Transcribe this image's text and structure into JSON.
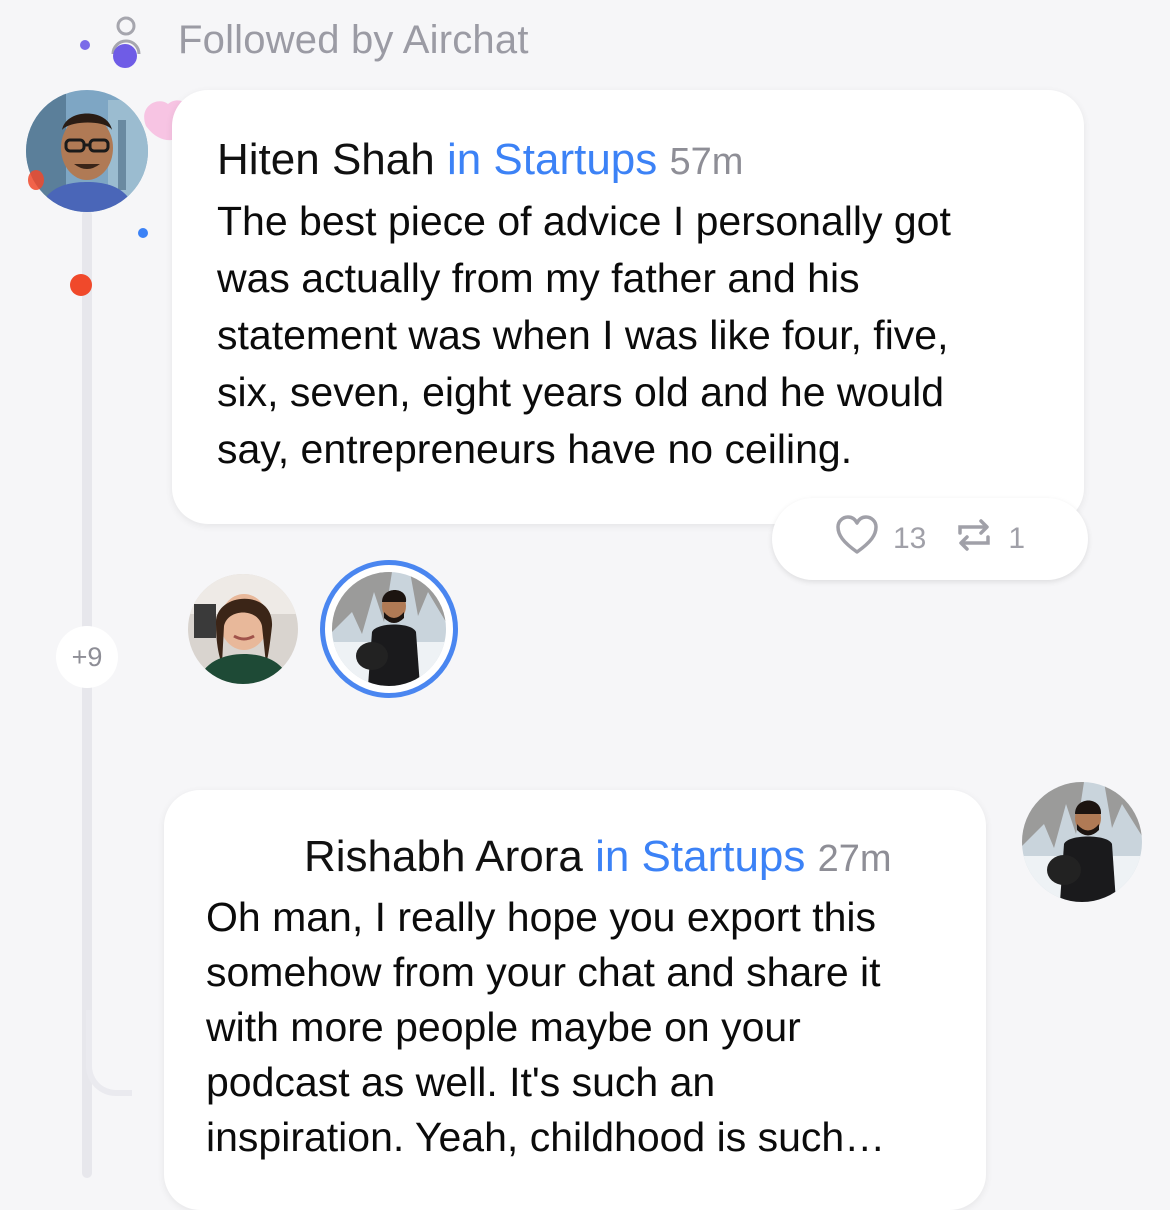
{
  "header": {
    "followed_label": "Followed by Airchat"
  },
  "posts": [
    {
      "author": "Hiten Shah",
      "community": "in Startups",
      "time": "57m",
      "body": "The best piece of advice I personally got\nwas actually from my father and his\nstatement was when I was like four, five,\nsix, seven, eight years old and he would\nsay, entrepreneurs have no ceiling.",
      "likes": "13",
      "reposts": "1"
    },
    {
      "author": "Rishabh Arora",
      "community": "in Startups",
      "time": "27m",
      "body": "Oh man, I really hope you export this\nsomehow from your chat and share it\nwith more people maybe on your\npodcast as well. It's such an\ninspiration. Yeah, childhood is such…"
    }
  ],
  "listeners": {
    "more_count": "+9"
  },
  "colors": {
    "accent": "#3c82f6",
    "muted": "#9b9ba4",
    "background": "#f6f6f8",
    "orange_dot": "#f0492b",
    "purple_dot": "#6f5ce6"
  },
  "icons": {
    "followed": "person-icon",
    "like": "heart-icon",
    "repost": "repost-icon"
  }
}
